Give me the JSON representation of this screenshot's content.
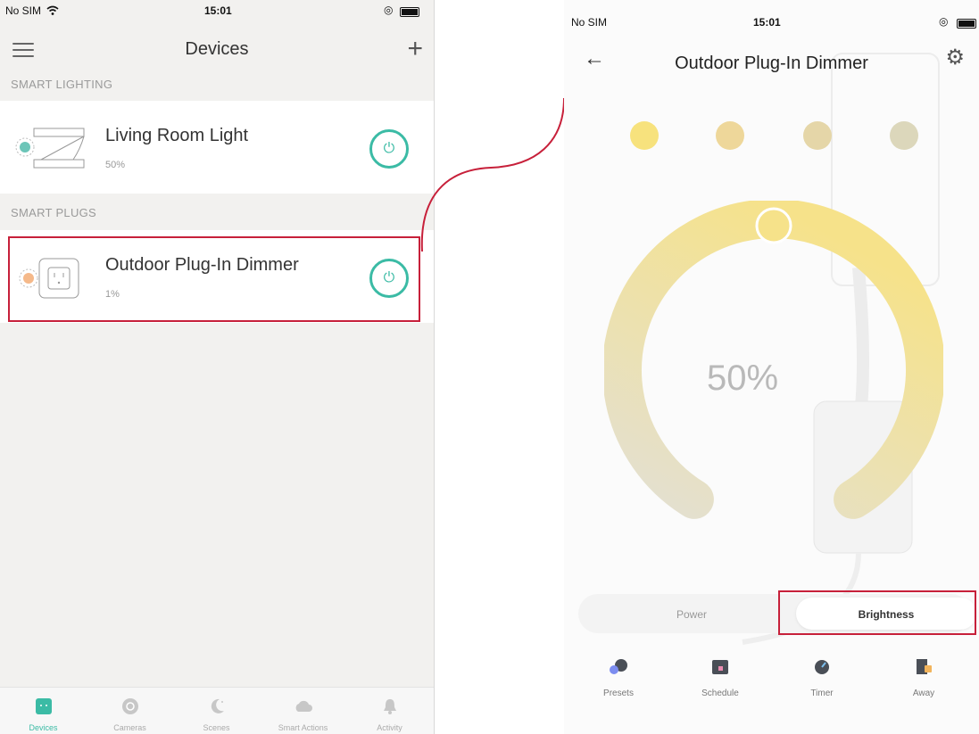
{
  "left": {
    "status": {
      "carrier": "No SIM",
      "time": "15:01"
    },
    "nav": {
      "title": "Devices"
    },
    "sections": [
      {
        "label": "SMART LIGHTING"
      },
      {
        "label": "SMART PLUGS"
      }
    ],
    "devices": [
      {
        "name": "Living Room Light",
        "level": "50%"
      },
      {
        "name": "Outdoor Plug-In Dimmer",
        "level": "1%"
      }
    ],
    "tabs": [
      {
        "label": "Devices",
        "icon": "plug-icon",
        "active": true
      },
      {
        "label": "Cameras",
        "icon": "camera-icon"
      },
      {
        "label": "Scenes",
        "icon": "moon-stars-icon"
      },
      {
        "label": "Smart Actions",
        "icon": "cloud-icon"
      },
      {
        "label": "Activity",
        "icon": "bell-icon"
      }
    ]
  },
  "right": {
    "status": {
      "carrier": "No SIM",
      "time": "15:01"
    },
    "nav": {
      "title": "Outdoor Plug-In Dimmer"
    },
    "preset_colors": [
      "#f7e27d",
      "#eed79a",
      "#e5d6a8",
      "#dcd7bb"
    ],
    "brightness": {
      "value": 50,
      "label": "50%"
    },
    "segmented": {
      "power": "Power",
      "brightness": "Brightness",
      "selected": "Brightness"
    },
    "actions": [
      {
        "label": "Presets",
        "icon": "presets-icon"
      },
      {
        "label": "Schedule",
        "icon": "calendar-icon"
      },
      {
        "label": "Timer",
        "icon": "timer-icon"
      },
      {
        "label": "Away",
        "icon": "away-icon"
      }
    ]
  },
  "colors": {
    "accent": "#3bbba5",
    "highlight": "#c7203a",
    "arc": "#f6e28a"
  }
}
